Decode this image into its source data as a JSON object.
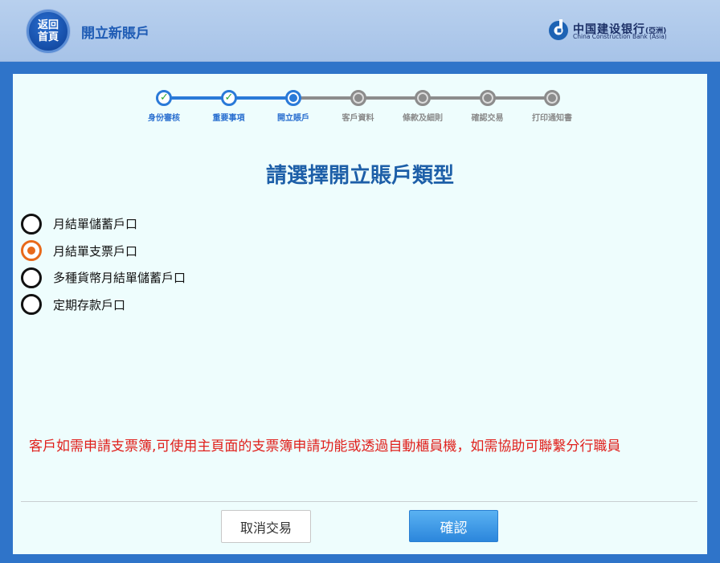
{
  "header": {
    "home_button": {
      "line1": "返回",
      "line2": "首頁"
    },
    "page_title": "開立新賬戶",
    "bank": {
      "name_cn": "中国建设银行",
      "name_cn_suffix": "(亞洲)",
      "name_en": "China Construction Bank (Asia)",
      "logo_icon": "ccb-logo-icon"
    }
  },
  "steps": [
    {
      "label": "身份審核",
      "status": "done"
    },
    {
      "label": "重要事項",
      "status": "done"
    },
    {
      "label": "開立賬戶",
      "status": "current"
    },
    {
      "label": "客戶資料",
      "status": "todo"
    },
    {
      "label": "條款及細則",
      "status": "todo"
    },
    {
      "label": "確認交易",
      "status": "todo"
    },
    {
      "label": "打印通知書",
      "status": "todo"
    }
  ],
  "question": "請選擇開立賬戶類型",
  "account_types": [
    {
      "label": "月結單儲蓄戶口",
      "selected": false
    },
    {
      "label": "月結單支票戶口",
      "selected": true
    },
    {
      "label": "多種貨幣月結單儲蓄戶口",
      "selected": false
    },
    {
      "label": "定期存款戶口",
      "selected": false
    }
  ],
  "notice": "客戶如需申請支票簿,可使用主頁面的支票簿申請功能或透過自動櫃員機，如需協助可聯繫分行職員",
  "buttons": {
    "cancel": "取消交易",
    "confirm": "確認"
  },
  "colors": {
    "accent_blue": "#2a7ad8",
    "selected_orange": "#e8691a",
    "notice_red": "#e0201c",
    "title_blue": "#1d5fa8"
  }
}
